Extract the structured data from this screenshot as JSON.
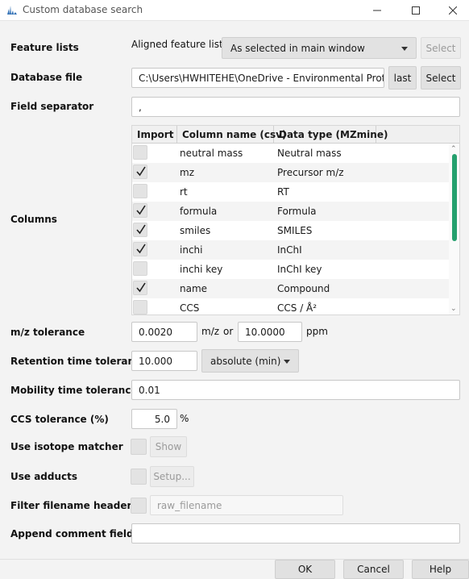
{
  "window": {
    "title": "Custom database search"
  },
  "feature_lists": {
    "label": "Feature lists",
    "type_label": "Aligned feature list...",
    "selection": "As selected in main window",
    "select_button": "Select"
  },
  "database_file": {
    "label": "Database file",
    "value": "C:\\Users\\HWHITEHE\\OneDrive - Environmental Protection",
    "last_button": "last",
    "select_button": "Select"
  },
  "field_separator": {
    "label": "Field separator",
    "value": ","
  },
  "columns": {
    "label": "Columns",
    "headers": [
      "Import",
      "Column name (csv)",
      "Data type (MZmine)"
    ],
    "rows": [
      {
        "checked": false,
        "column": "neutral mass",
        "type": "Neutral mass"
      },
      {
        "checked": true,
        "column": "mz",
        "type": "Precursor m/z"
      },
      {
        "checked": false,
        "column": "rt",
        "type": "RT"
      },
      {
        "checked": true,
        "column": "formula",
        "type": "Formula"
      },
      {
        "checked": true,
        "column": "smiles",
        "type": "SMILES"
      },
      {
        "checked": true,
        "column": "inchi",
        "type": "InChI"
      },
      {
        "checked": false,
        "column": "inchi key",
        "type": "InChI key"
      },
      {
        "checked": true,
        "column": "name",
        "type": "Compound"
      },
      {
        "checked": false,
        "column": "CCS",
        "type": "CCS / Å²"
      }
    ]
  },
  "mz_tolerance": {
    "label": "m/z tolerance",
    "mz_value": "0.0020",
    "mz_unit": "m/z",
    "or": "or",
    "ppm_value": "10.0000",
    "ppm_unit": "ppm"
  },
  "rt_tolerance": {
    "label": "Retention time tolerance",
    "value": "10.000",
    "mode": "absolute (min)"
  },
  "mobility_tolerance": {
    "label": "Mobility time tolerance",
    "value": "0.01"
  },
  "ccs_tolerance": {
    "label": "CCS tolerance (%)",
    "value": "5.0",
    "unit": "%"
  },
  "isotope_matcher": {
    "label": "Use isotope matcher",
    "button": "Show"
  },
  "adducts": {
    "label": "Use adducts",
    "button": "Setup..."
  },
  "filter_filename": {
    "label": "Filter filename header",
    "placeholder": "raw_filename"
  },
  "append_comment": {
    "label": "Append comment fields",
    "value": ""
  },
  "buttons": {
    "ok": "OK",
    "cancel": "Cancel",
    "help": "Help"
  }
}
